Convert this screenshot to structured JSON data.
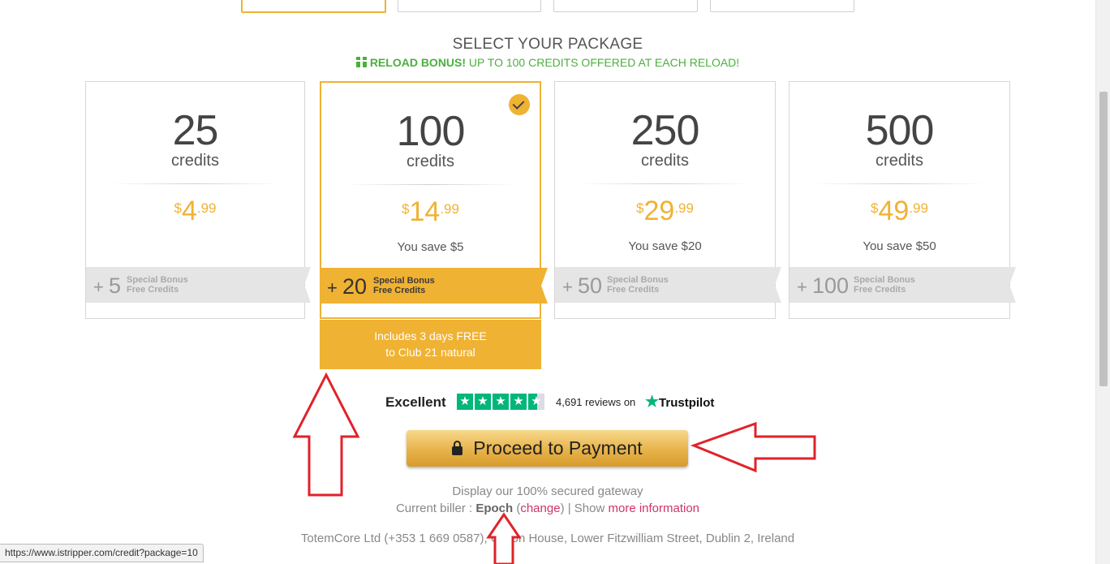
{
  "heading": "SELECT YOUR PACKAGE",
  "reload": {
    "strong": "RELOAD BONUS!",
    "text": " UP TO 100 CREDITS OFFERED AT EACH RELOAD!"
  },
  "packages": [
    {
      "credits": "25",
      "unit": "credits",
      "currency": "$",
      "price_whole": "4",
      "price_cents": ".99",
      "savings": "",
      "bonus_plus": "+",
      "bonus": "5",
      "bonus_label1": "Special Bonus",
      "bonus_label2": "Free Credits",
      "selected": false
    },
    {
      "credits": "100",
      "unit": "credits",
      "currency": "$",
      "price_whole": "14",
      "price_cents": ".99",
      "savings": "You save $5",
      "bonus_plus": "+",
      "bonus": "20",
      "bonus_label1": "Special Bonus",
      "bonus_label2": "Free Credits",
      "selected": true
    },
    {
      "credits": "250",
      "unit": "credits",
      "currency": "$",
      "price_whole": "29",
      "price_cents": ".99",
      "savings": "You save $20",
      "bonus_plus": "+",
      "bonus": "50",
      "bonus_label1": "Special Bonus",
      "bonus_label2": "Free Credits",
      "selected": false
    },
    {
      "credits": "500",
      "unit": "credits",
      "currency": "$",
      "price_whole": "49",
      "price_cents": ".99",
      "savings": "You save $50",
      "bonus_plus": "+",
      "bonus": "100",
      "bonus_label1": "Special Bonus",
      "bonus_label2": "Free Credits",
      "selected": false
    }
  ],
  "club": {
    "line1": "Includes 3 days FREE",
    "line2": "to Club 21 natural"
  },
  "trustpilot": {
    "rating_text": "Excellent",
    "stars": 4.5,
    "reviews": "4,691 reviews on",
    "brand": "Trustpilot"
  },
  "proceed_label": "Proceed to Payment",
  "gateway_text": "Display our 100% secured gateway",
  "biller": {
    "prefix": "Current biller : ",
    "name": "Epoch",
    "open": " (",
    "change": "change",
    "close": ") | Show ",
    "more": "more information"
  },
  "address": "TotemCore Ltd (+353 1 669 0587), Clifton House, Lower Fitzwilliam Street, Dublin 2, Ireland",
  "status_url": "https://www.istripper.com/credit?package=10",
  "colors": {
    "accent": "#f0b233",
    "green": "#4caf3e",
    "link": "#d0336a",
    "trustpilot": "#00b67a",
    "annotation": "#e0222a"
  }
}
